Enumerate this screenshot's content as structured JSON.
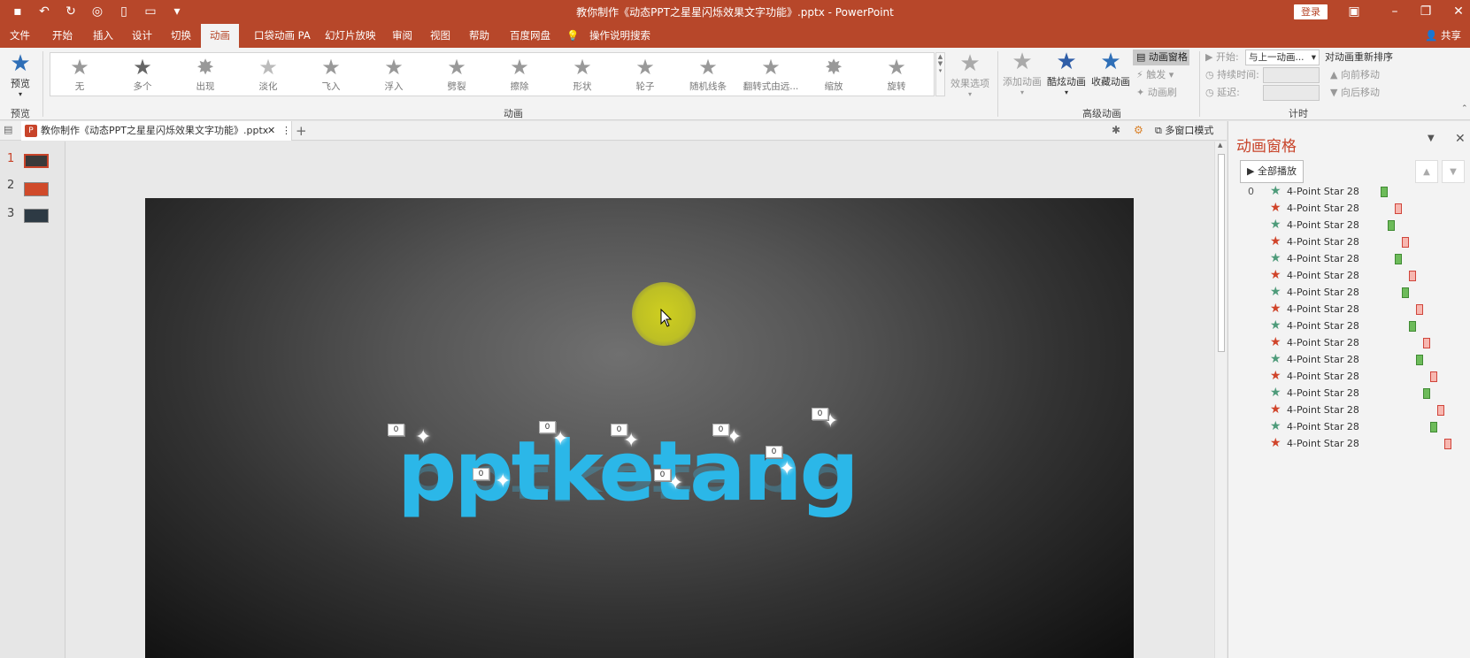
{
  "window": {
    "title": "教你制作《动态PPT之星星闪烁效果文字功能》.pptx - PowerPoint",
    "login_label": "登录",
    "share_label": "共享",
    "qat_icons": [
      "save-icon",
      "undo-icon",
      "redo-icon",
      "present-icon",
      "new-icon",
      "open-icon",
      "customize-icon"
    ]
  },
  "tabs": [
    {
      "label": "文件"
    },
    {
      "label": "开始"
    },
    {
      "label": "插入"
    },
    {
      "label": "设计"
    },
    {
      "label": "切换"
    },
    {
      "label": "动画",
      "active": true
    },
    {
      "label": "口袋动画 PA"
    },
    {
      "label": "幻灯片放映"
    },
    {
      "label": "审阅"
    },
    {
      "label": "视图"
    },
    {
      "label": "帮助"
    },
    {
      "label": "百度网盘"
    },
    {
      "label": "操作说明搜索"
    }
  ],
  "ribbon": {
    "preview_label": "预览",
    "group_preview": "预览",
    "group_animation": "动画",
    "group_advanced": "高级动画",
    "group_timing": "计时",
    "gallery": [
      "无",
      "多个",
      "出现",
      "淡化",
      "飞入",
      "浮入",
      "劈裂",
      "擦除",
      "形状",
      "轮子",
      "随机线条",
      "翻转式由远...",
      "缩放",
      "旋转"
    ],
    "effect_options": "效果选项",
    "add_animation": "添加动画",
    "cool_animation": "酷炫动画",
    "fav_animation": "收藏动画",
    "anim_pane_btn": "动画窗格",
    "trigger": "触发",
    "anim_painter": "动画刷",
    "start_label": "开始:",
    "start_value": "与上一动画...",
    "duration_label": "持续时间:",
    "delay_label": "延迟:",
    "reorder_title": "对动画重新排序",
    "move_earlier": "向前移动",
    "move_later": "向后移动"
  },
  "doc_tab": {
    "name": "教你制作《动态PPT之星星闪烁效果文字功能》.pptx",
    "multi_window": "多窗口模式"
  },
  "slides": [
    {
      "num": "1",
      "color": "#3a3a3a",
      "active": true
    },
    {
      "num": "2",
      "color": "#d04a2a"
    },
    {
      "num": "3",
      "color": "#2d3a44"
    }
  ],
  "slide": {
    "word": "pptketang",
    "badge_label": "0"
  },
  "pane": {
    "title": "动画窗格",
    "play_all": "全部播放",
    "items": [
      {
        "idx": "0",
        "name": "4-Point Star 28",
        "kind": "entrance",
        "offset": 0
      },
      {
        "idx": "",
        "name": "4-Point Star 28",
        "kind": "exit",
        "offset": 1
      },
      {
        "idx": "",
        "name": "4-Point Star 28",
        "kind": "entrance",
        "offset": 0.5
      },
      {
        "idx": "",
        "name": "4-Point Star 28",
        "kind": "exit",
        "offset": 1.5
      },
      {
        "idx": "",
        "name": "4-Point Star 28",
        "kind": "entrance",
        "offset": 1
      },
      {
        "idx": "",
        "name": "4-Point Star 28",
        "kind": "exit",
        "offset": 2
      },
      {
        "idx": "",
        "name": "4-Point Star 28",
        "kind": "entrance",
        "offset": 1.5
      },
      {
        "idx": "",
        "name": "4-Point Star 28",
        "kind": "exit",
        "offset": 2.5
      },
      {
        "idx": "",
        "name": "4-Point Star 28",
        "kind": "entrance",
        "offset": 2
      },
      {
        "idx": "",
        "name": "4-Point Star 28",
        "kind": "exit",
        "offset": 3
      },
      {
        "idx": "",
        "name": "4-Point Star 28",
        "kind": "entrance",
        "offset": 2.5
      },
      {
        "idx": "",
        "name": "4-Point Star 28",
        "kind": "exit",
        "offset": 3.5
      },
      {
        "idx": "",
        "name": "4-Point Star 28",
        "kind": "entrance",
        "offset": 3
      },
      {
        "idx": "",
        "name": "4-Point Star 28",
        "kind": "exit",
        "offset": 4
      },
      {
        "idx": "",
        "name": "4-Point Star 28",
        "kind": "entrance",
        "offset": 3.5
      },
      {
        "idx": "",
        "name": "4-Point Star 28",
        "kind": "exit",
        "offset": 4.5
      }
    ]
  },
  "colors": {
    "accent": "#b7472a",
    "entrance_star": "#4e9b7a",
    "exit_star": "#d0442a",
    "entrance_bar": "#6dbb5a",
    "exit_bar": "#f7b7b0"
  }
}
